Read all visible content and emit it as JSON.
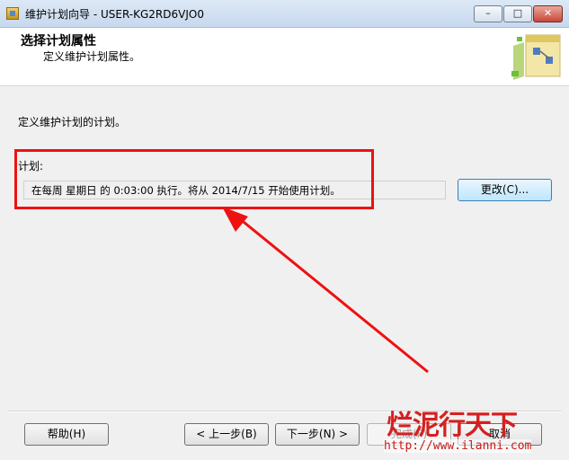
{
  "window": {
    "title": "维护计划向导 - USER-KG2RD6VJO0",
    "minimize_label": "–",
    "maximize_label": "□",
    "close_label": "✕"
  },
  "header": {
    "title": "选择计划属性",
    "subtitle": "定义维护计划属性。",
    "icon": "wizard-icon"
  },
  "body": {
    "description": "定义维护计划的计划。",
    "schedule_label": "计划:",
    "schedule_text": "在每周 星期日 的 0:03:00 执行。将从 2014/7/15 开始使用计划。",
    "change_button": "更改(C)..."
  },
  "footer": {
    "help": "帮助(H)",
    "prev": "< 上一步(B)",
    "next": "下一步(N) >",
    "finish": "完成(F)",
    "cancel": "取消"
  },
  "watermark": {
    "text": "烂泥行天下",
    "url": "http://www.ilanni.com"
  },
  "colors": {
    "annotation": "#ee1111",
    "watermark": "#d42020"
  }
}
